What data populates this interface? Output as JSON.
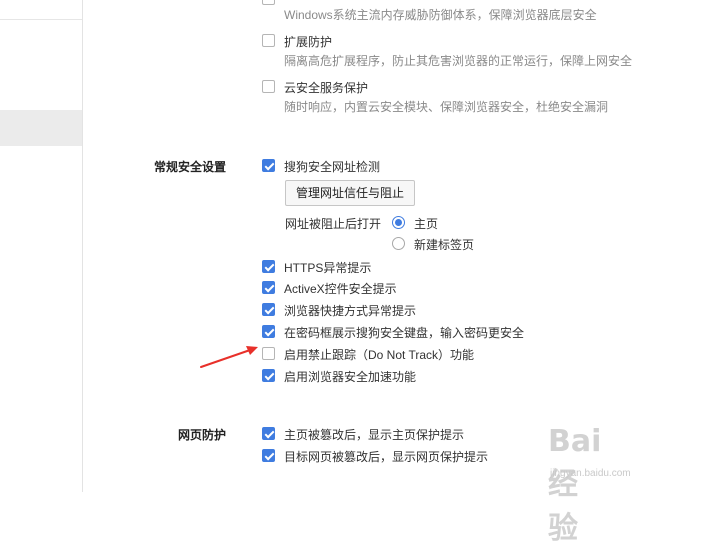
{
  "extension": {
    "top_desc": "Windows系统主流内存威胁防御体系，保障浏览器底层安全",
    "ext_protect_label": "扩展防护",
    "ext_protect_checked": false,
    "ext_protect_desc": "隔离高危扩展程序，防止其危害浏览器的正常运行，保障上网安全",
    "cloud_label": "云安全服务保护",
    "cloud_checked": false,
    "cloud_desc": "随时响应，内置云安全模块、保障浏览器安全，杜绝安全漏洞"
  },
  "general": {
    "section_title": "常规安全设置",
    "url_check_label": "搜狗安全网址检测",
    "url_check_checked": true,
    "manage_button": "管理网址信任与阻止",
    "blocked_open_label": "网址被阻止后打开",
    "radio_home": "主页",
    "radio_newtab": "新建标签页",
    "radio_selected": "home",
    "https_label": "HTTPS异常提示",
    "activex_label": "ActiveX控件安全提示",
    "shortcut_label": "浏览器快捷方式异常提示",
    "keyboard_label": "在密码框展示搜狗安全键盘，输入密码更安全",
    "dnt_label": "启用禁止跟踪（Do Not Track）功能",
    "dnt_checked": false,
    "accel_label": "启用浏览器安全加速功能"
  },
  "webpage": {
    "section_title": "网页防护",
    "home_tamper_label": "主页被篡改后，显示主页保护提示",
    "target_tamper_label": "目标网页被篡改后，显示网页保护提示"
  },
  "watermark": {
    "logo": "Bai 经验",
    "url": "jingyan.baidu.com"
  },
  "colors": {
    "accent": "#3f7ce0",
    "annotation_arrow": "#e8302a"
  }
}
